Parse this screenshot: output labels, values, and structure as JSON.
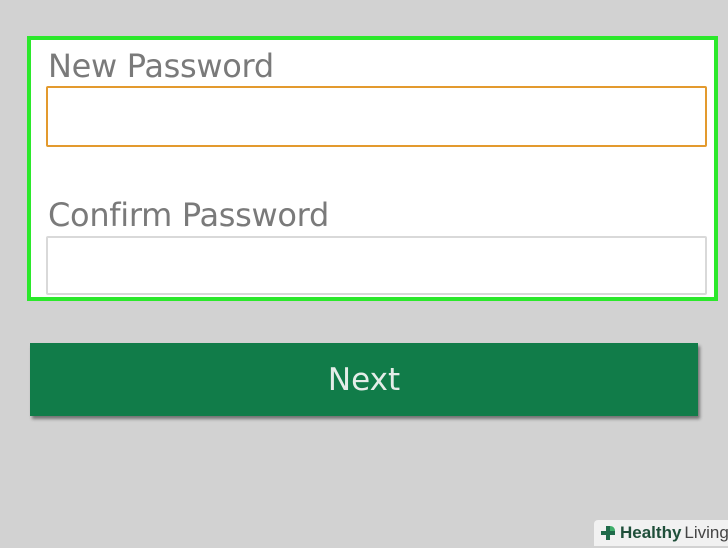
{
  "form": {
    "new_password": {
      "label": "New Password",
      "value": "",
      "placeholder": ""
    },
    "confirm_password": {
      "label": "Confirm Password",
      "value": "",
      "placeholder": ""
    }
  },
  "actions": {
    "next_label": "Next"
  },
  "watermark": {
    "brand_bold": "Healthy",
    "brand_light": "Living"
  },
  "colors": {
    "background": "#d2d2d2",
    "highlight_border": "#2be82b",
    "focused_input_border": "#e39a2e",
    "input_border": "#d9d9d9",
    "button_background": "#117c49",
    "button_text": "#e4ede8",
    "label_text": "#7a7a7a"
  },
  "icons": {
    "watermark_logo": "plus-leaf-icon"
  }
}
